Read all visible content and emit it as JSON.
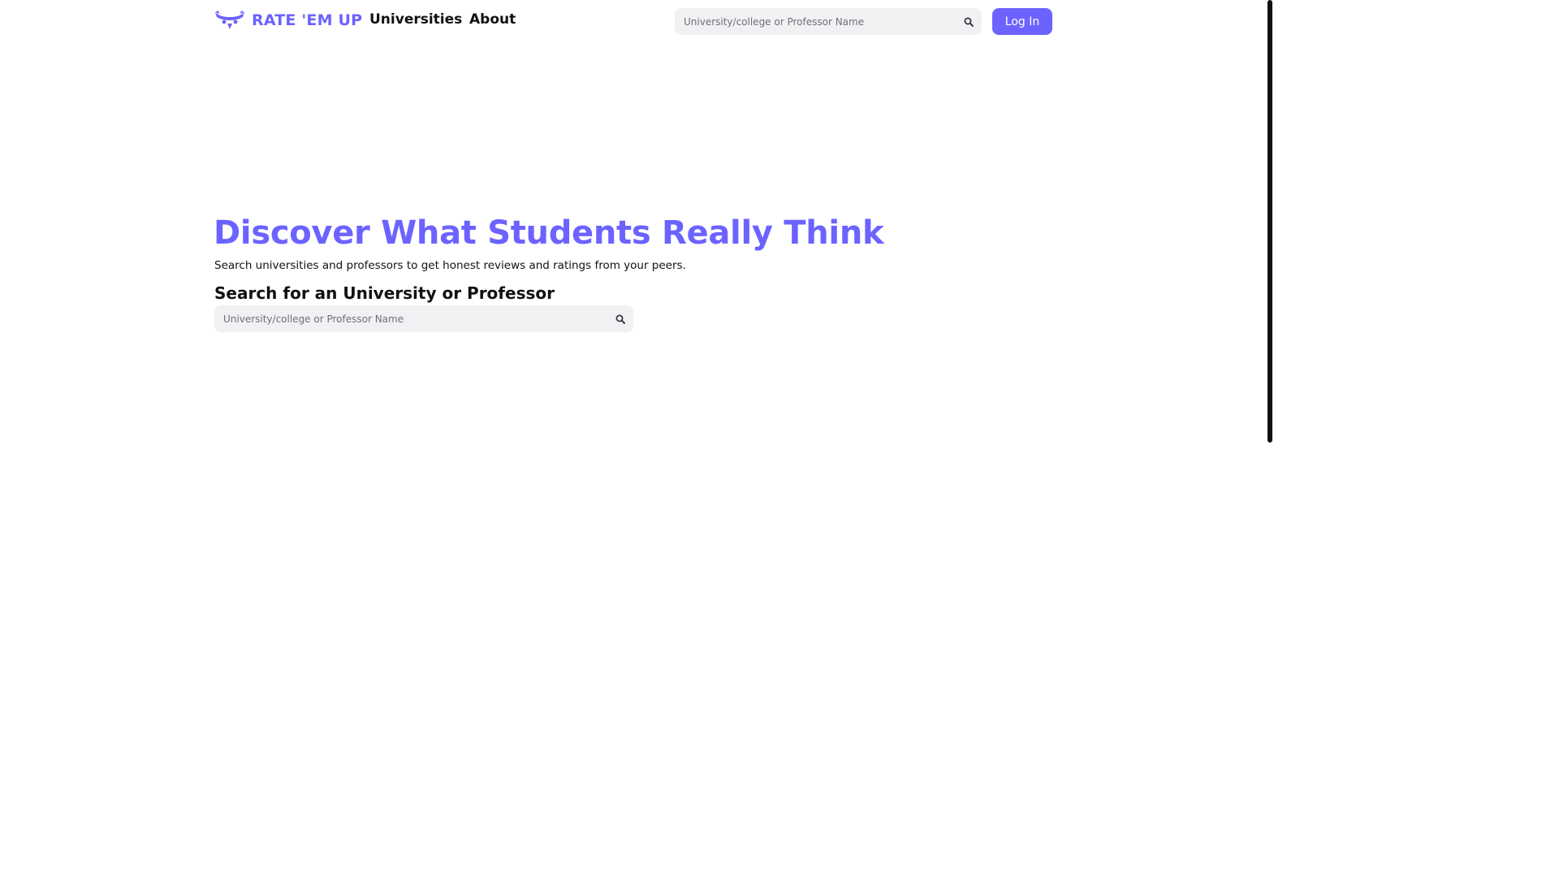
{
  "header": {
    "logo_text": "RATE 'EM UP",
    "logo_icon": "owl-icon",
    "nav": {
      "universities": "Universities",
      "about": "About"
    },
    "search": {
      "placeholder": "University/college or Professor Name",
      "value": "",
      "icon": "search-icon"
    },
    "login_label": "Log In"
  },
  "hero": {
    "title": "Discover What Students Really Think",
    "subtitle": "Search universities and professors to get honest reviews and ratings from your peers.",
    "search_heading": "Search for an University or Professor",
    "search": {
      "placeholder": "University/college or Professor Name",
      "value": "",
      "icon": "search-icon"
    }
  },
  "colors": {
    "accent": "#6c63ff",
    "input_bg": "#f1f1f3",
    "text": "#111111"
  }
}
